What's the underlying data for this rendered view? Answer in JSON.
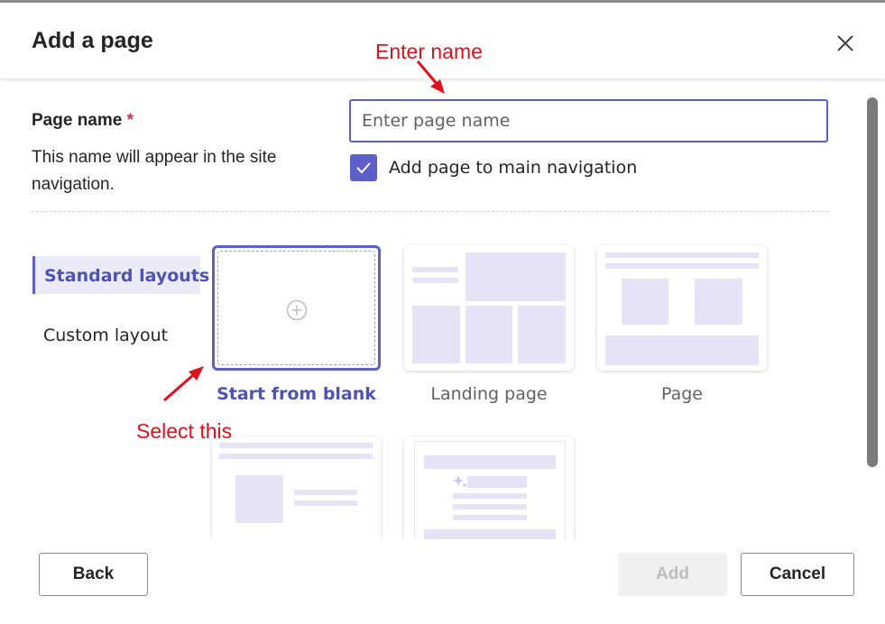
{
  "dialog": {
    "title": "Add a page",
    "close_icon": "close-icon"
  },
  "annotations": {
    "enter_name": "Enter name",
    "select_this": "Select this"
  },
  "form": {
    "page_name_label": "Page name",
    "required_marker": "*",
    "help_text": "This name will appear in the site navigation.",
    "name_input": {
      "value": "",
      "placeholder": "Enter page name"
    },
    "nav_checkbox": {
      "checked": true,
      "label": "Add page to main navigation"
    }
  },
  "layout_nav": {
    "items": [
      {
        "label": "Standard layouts",
        "selected": true
      },
      {
        "label": "Custom layout",
        "selected": false
      }
    ]
  },
  "templates": [
    {
      "label": "Start from blank",
      "selected": true,
      "icon": "plus-circle-icon"
    },
    {
      "label": "Landing page",
      "selected": false
    },
    {
      "label": "Page",
      "selected": false
    },
    {
      "label": "",
      "selected": false
    },
    {
      "label": "",
      "selected": false
    }
  ],
  "footer": {
    "back_label": "Back",
    "add_label": "Add",
    "add_disabled": true,
    "cancel_label": "Cancel"
  },
  "colors": {
    "accent": "#5b5fc7",
    "annotation": "#e0101a",
    "layout_block": "#e6e3f7"
  }
}
